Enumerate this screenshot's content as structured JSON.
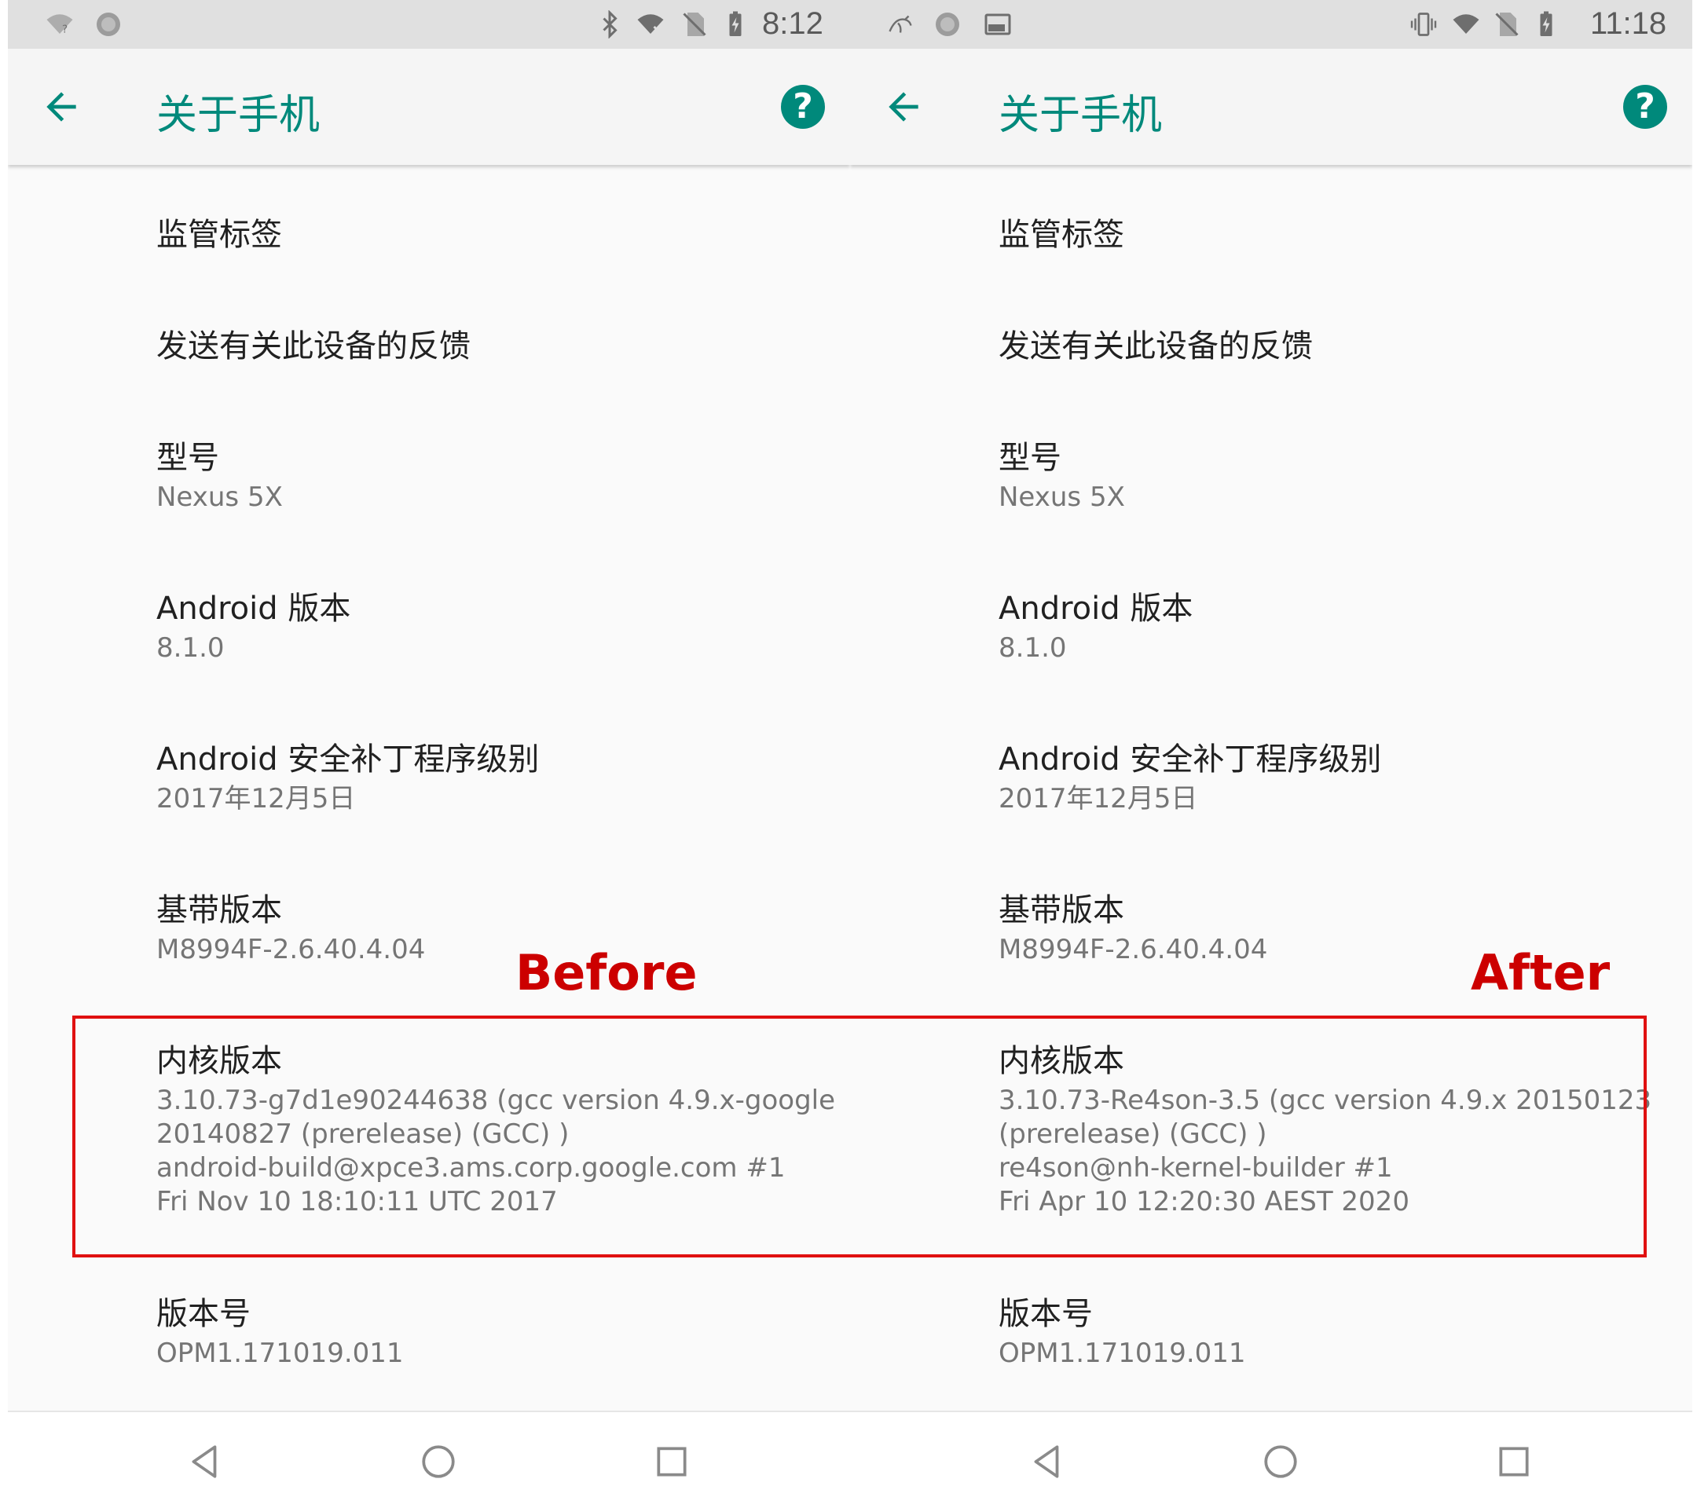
{
  "annotations": {
    "before_label": "Before",
    "after_label": "After"
  },
  "screens": {
    "left": {
      "status_time": "8:12",
      "title": "关于手机",
      "help_glyph": "?",
      "items": [
        {
          "title": "监管标签",
          "value_lines": []
        },
        {
          "title": "发送有关此设备的反馈",
          "value_lines": []
        },
        {
          "title": "型号",
          "value_lines": [
            "Nexus 5X"
          ]
        },
        {
          "title": "Android 版本",
          "value_lines": [
            "8.1.0"
          ]
        },
        {
          "title": "Android 安全补丁程序级别",
          "value_lines": [
            "2017年12月5日"
          ]
        },
        {
          "title": "基带版本",
          "value_lines": [
            "M8994F-2.6.40.4.04"
          ]
        },
        {
          "title": "内核版本",
          "value_lines": [
            "3.10.73-g7d1e90244638 (gcc version 4.9.x-google",
            "20140827 (prerelease) (GCC) )",
            "android-build@xpce3.ams.corp.google.com #1",
            "Fri Nov 10 18:10:11 UTC 2017"
          ]
        },
        {
          "title": "版本号",
          "value_lines": [
            "OPM1.171019.011"
          ]
        }
      ]
    },
    "right": {
      "status_time": "11:18",
      "title": "关于手机",
      "help_glyph": "?",
      "items": [
        {
          "title": "监管标签",
          "value_lines": []
        },
        {
          "title": "发送有关此设备的反馈",
          "value_lines": []
        },
        {
          "title": "型号",
          "value_lines": [
            "Nexus 5X"
          ]
        },
        {
          "title": "Android 版本",
          "value_lines": [
            "8.1.0"
          ]
        },
        {
          "title": "Android 安全补丁程序级别",
          "value_lines": [
            "2017年12月5日"
          ]
        },
        {
          "title": "基带版本",
          "value_lines": [
            "M8994F-2.6.40.4.04"
          ]
        },
        {
          "title": "内核版本",
          "value_lines": [
            "3.10.73-Re4son-3.5 (gcc version 4.9.x 20150123",
            "(prerelease) (GCC) )",
            "re4son@nh-kernel-builder #1",
            "Fri Apr 10 12:20:30 AEST 2020"
          ]
        },
        {
          "title": "版本号",
          "value_lines": [
            "OPM1.171019.011"
          ]
        }
      ]
    }
  },
  "colors": {
    "accent": "#00897b",
    "annotation_red": "#cc0000"
  }
}
